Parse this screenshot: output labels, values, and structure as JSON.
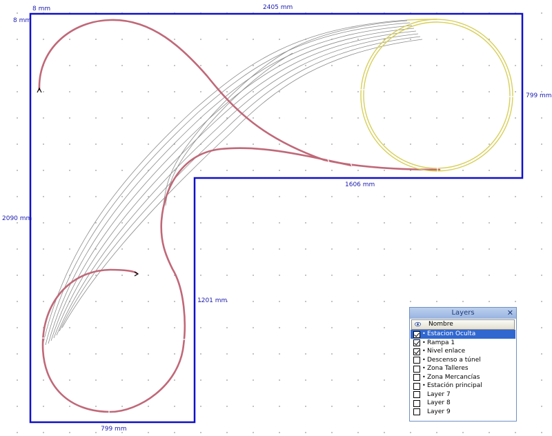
{
  "dimensions": {
    "top_width": "2405 mm",
    "top_left_x": "8 mm",
    "top_left_y": "8 mm",
    "right_height": "799 mm",
    "inner_width": "1606 mm",
    "left_height": "2090 mm",
    "inner_height": "1201 mm",
    "bottom_width": "799 mm"
  },
  "layers_panel": {
    "title": "Layers",
    "close_glyph": "✕",
    "column_header": "Nombre",
    "layers": [
      {
        "name": "Estacion Oculta",
        "checked": true,
        "selected": true
      },
      {
        "name": "Rampa 1",
        "checked": true,
        "selected": false
      },
      {
        "name": "Nivel enlace",
        "checked": true,
        "selected": false
      },
      {
        "name": "Descenso a túnel",
        "checked": false,
        "selected": false
      },
      {
        "name": "Zona Talleres",
        "checked": false,
        "selected": false
      },
      {
        "name": "Zona Mercancías",
        "checked": false,
        "selected": false
      },
      {
        "name": "Estación principal",
        "checked": false,
        "selected": false
      },
      {
        "name": "Layer 7",
        "checked": false,
        "selected": false
      },
      {
        "name": "Layer 8",
        "checked": false,
        "selected": false
      },
      {
        "name": "Layer 9",
        "checked": false,
        "selected": false
      }
    ]
  },
  "colors": {
    "board_outline": "#1010c8",
    "track_red": "#c06878",
    "track_yellow": "#e8e070",
    "track_grey": "#8a8a8a",
    "dimension_text": "#1a1ab0",
    "panel_selection": "#3168d0"
  },
  "icons": {
    "layer_visibility": "eye-icon",
    "close": "close-icon"
  }
}
